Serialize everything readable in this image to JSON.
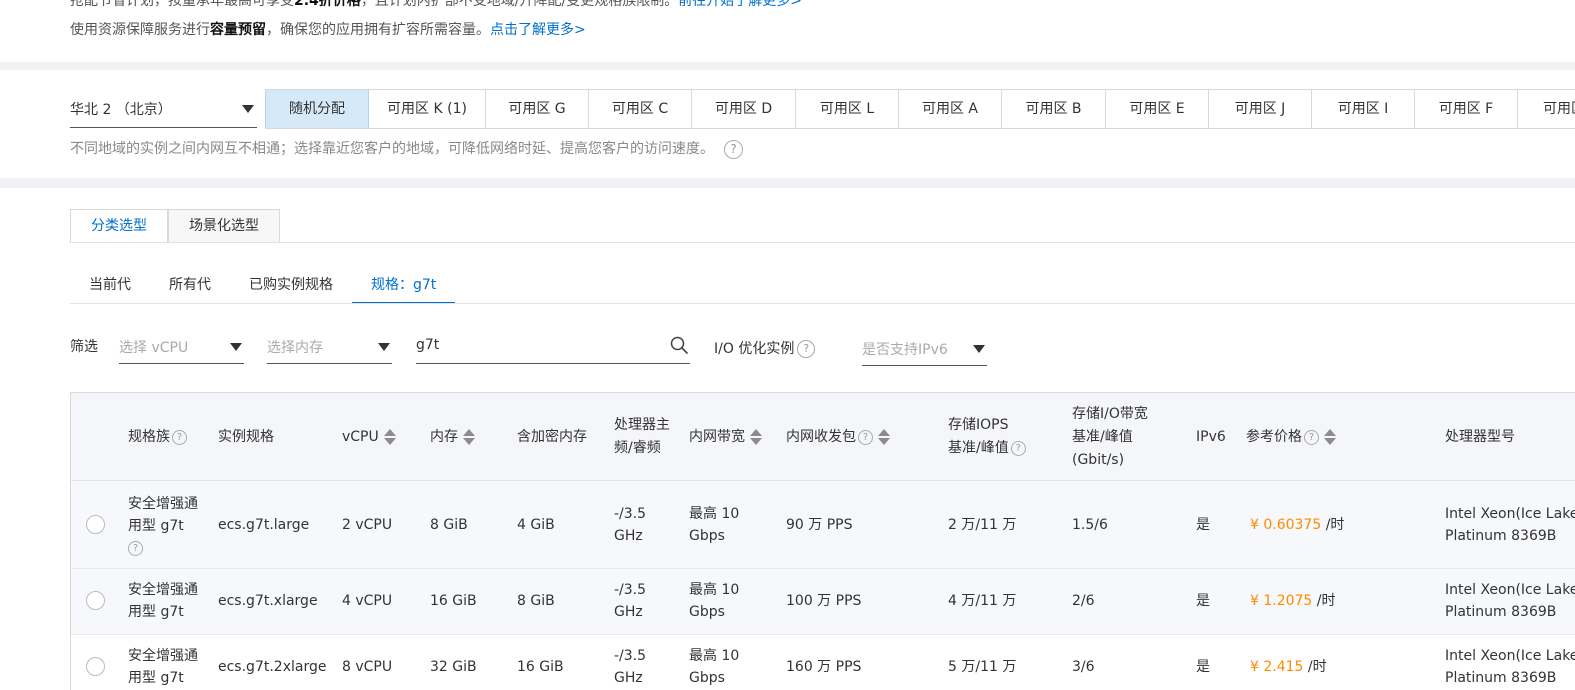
{
  "notice": {
    "line1_prefix": "抢配节省计划，按量承年最高可享受",
    "line1_bold": "2.4折价格",
    "line1_mid": "，且计划内扩部不受地域/升降配/变更规格族限制。",
    "line1_link": "前往开始了解更多>",
    "line2_prefix": "使用资源保障服务进行",
    "line2_bold": "容量预留",
    "line2_mid": "，确保您的应用拥有扩容所需容量。",
    "line2_link": "点击了解更多>"
  },
  "region": {
    "value": "华北 2 （北京）",
    "zones": [
      "随机分配",
      "可用区 K (1)",
      "可用区 G",
      "可用区 C",
      "可用区 D",
      "可用区 L",
      "可用区 A",
      "可用区 B",
      "可用区 E",
      "可用区 J",
      "可用区 I",
      "可用区 F",
      "可用区"
    ],
    "hint": "不同地域的实例之间内网互不相通；选择靠近您客户的地域，可降低网络时延、提高您客户的访问速度。"
  },
  "select_tabs": [
    "分类选型",
    "场景化选型"
  ],
  "gen_tabs": [
    "当前代",
    "所有代",
    "已购实例规格",
    "规格：g7t"
  ],
  "filter": {
    "label": "筛选",
    "vcpu_placeholder": "选择 vCPU",
    "memory_placeholder": "选择内存",
    "search_value": "g7t",
    "io_label": "I/O 优化实例",
    "ipv6_placeholder": "是否支持IPv6"
  },
  "table": {
    "headers": {
      "family": "规格族",
      "spec": "实例规格",
      "vcpu": "vCPU",
      "memory": "内存",
      "enc_memory": "含加密内存",
      "freq_l1": "处理器主",
      "freq_l2": "频/睿频",
      "bandwidth": "内网带宽",
      "pps": "内网收发包",
      "iops_l1": "存储IOPS",
      "iops_l2": "基准/峰值",
      "io_bw_l1": "存储I/O带宽",
      "io_bw_l2": "基准/峰值",
      "io_bw_l3": "(Gbit/s)",
      "ipv6": "IPv6",
      "price": "参考价格",
      "cpu_model": "处理器型号"
    },
    "rows": [
      {
        "family_l1": "安全增强通",
        "family_l2": "用型 g7t",
        "spec": "ecs.g7t.large",
        "vcpu": "2 vCPU",
        "memory": "8 GiB",
        "enc_memory": "4 GiB",
        "freq_l1": "-/3.5",
        "freq_l2": "GHz",
        "bw_l1": "最高 10",
        "bw_l2": "Gbps",
        "pps": "90 万 PPS",
        "iops": "2 万/11 万",
        "io_bw": "1.5/6",
        "ipv6": "是",
        "price": "¥ 0.60375",
        "price_unit": "/时",
        "cpu_l1": "Intel Xeon(Ice Lake)",
        "cpu_l2": "Platinum 8369B"
      },
      {
        "family_l1": "安全增强通",
        "family_l2": "用型 g7t",
        "spec": "ecs.g7t.xlarge",
        "vcpu": "4 vCPU",
        "memory": "16 GiB",
        "enc_memory": "8 GiB",
        "freq_l1": "-/3.5",
        "freq_l2": "GHz",
        "bw_l1": "最高 10",
        "bw_l2": "Gbps",
        "pps": "100 万 PPS",
        "iops": "4 万/11 万",
        "io_bw": "2/6",
        "ipv6": "是",
        "price": "¥ 1.2075",
        "price_unit": "/时",
        "cpu_l1": "Intel Xeon(Ice Lake)",
        "cpu_l2": "Platinum 8369B"
      },
      {
        "family_l1": "安全增强通",
        "family_l2": "用型 g7t",
        "spec": "ecs.g7t.2xlarge",
        "vcpu": "8 vCPU",
        "memory": "32 GiB",
        "enc_memory": "16 GiB",
        "freq_l1": "-/3.5",
        "freq_l2": "GHz",
        "bw_l1": "最高 10",
        "bw_l2": "Gbps",
        "pps": "160 万 PPS",
        "iops": "5 万/11 万",
        "io_bw": "3/6",
        "ipv6": "是",
        "price": "¥ 2.415",
        "price_unit": "/时",
        "cpu_l1": "Intel Xeon(Ice Lake)",
        "cpu_l2": "Platinum 8369B"
      }
    ]
  },
  "colors": {
    "accent": "#0070cc",
    "price": "#ff8a00",
    "active_zone_bg": "#d6e9f8",
    "band": "#f0f1f5"
  }
}
